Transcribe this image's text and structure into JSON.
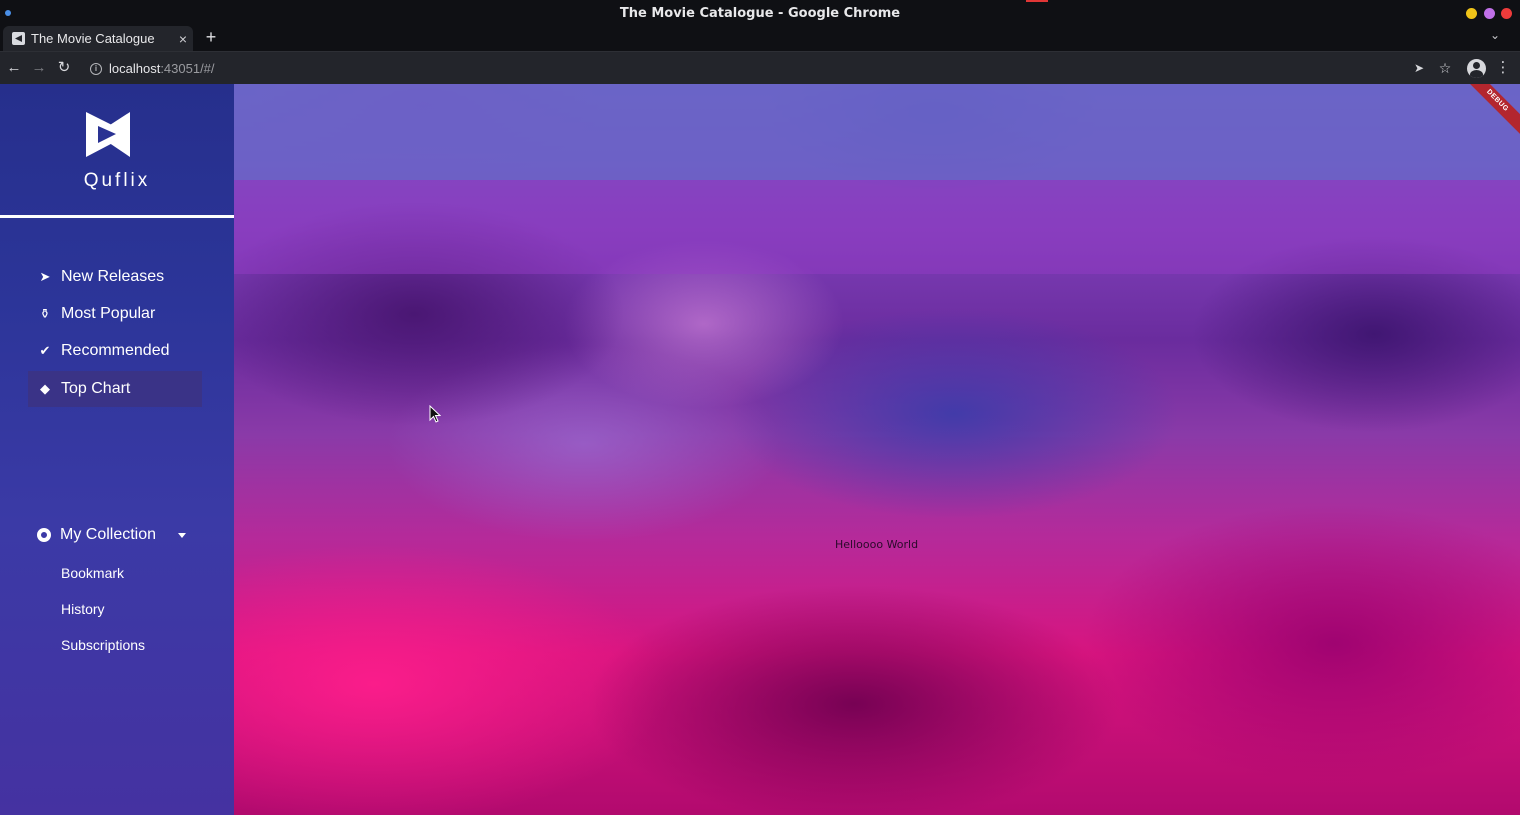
{
  "window": {
    "title": "The Movie Catalogue - Google Chrome"
  },
  "browser": {
    "tab_label": "The Movie Catalogue",
    "tab_close": "×",
    "new_tab": "+",
    "url_host": "localhost",
    "url_path": ":43051/#/"
  },
  "app": {
    "brand": "Quflix",
    "nav": [
      {
        "label": "New Releases",
        "icon": "rocket-icon"
      },
      {
        "label": "Most Popular",
        "icon": "trophy-icon"
      },
      {
        "label": "Recommended",
        "icon": "badge-check-icon"
      },
      {
        "label": "Top Chart",
        "icon": "gem-icon",
        "active": true
      }
    ],
    "collection": {
      "label": "My Collection",
      "items": [
        "Bookmark",
        "History",
        "Subscriptions"
      ]
    },
    "content_text": "Helloooo World",
    "debug_banner": "DEBUG"
  },
  "colors": {
    "sidebar": "#2c3599",
    "accent_pink": "#d8147f",
    "accent_purple": "#6a2c9e"
  }
}
